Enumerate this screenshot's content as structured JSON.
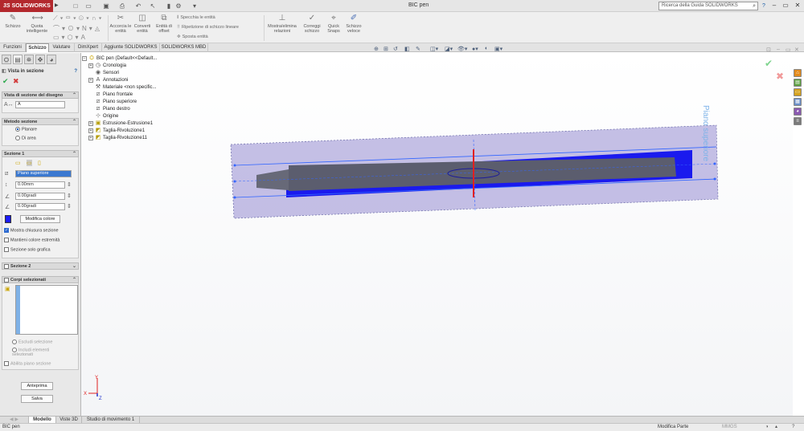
{
  "titlebar": {
    "logo": "SOLIDWORKS",
    "logo_ds": "3S",
    "doc_title": "BIC pen",
    "search_placeholder": "Ricerca della Guida SOLIDWORKS"
  },
  "ribbon": {
    "schizzo": "Schizzo",
    "quota_intelligente": "Quota intelligente",
    "accorcia_entita": "Accorcia le entità",
    "converti_entita": "Converti entità",
    "entita_offset": "Entità di offset",
    "specchia": "Specchia le entità",
    "ripetizione": "Ripetizione di schizzo lineare",
    "sposta": "Sposta entità",
    "mostra_elimina": "Mostra/elimina relazioni",
    "correggi": "Correggi schizzo",
    "quick_snaps": "Quick Snaps",
    "schizzo_veloce": "Schizzo veloce"
  },
  "cmd_tabs": [
    "Funzioni",
    "Schizzo",
    "Valutare",
    "DimXpert",
    "Aggiunte SOLIDWORKS",
    "SOLIDWORKS MBD"
  ],
  "propman": {
    "title": "Vista in sezione",
    "vista_label": "Vista di sezione del disegno",
    "vista_value": "A",
    "metodo_label": "Metodo sezione",
    "planare": "Planare",
    "di_area": "Di area",
    "sezione1": "Sezione 1",
    "plane_value": "Piano superiore",
    "offset_value": "0.00mm",
    "angle1_value": "0.00gradi",
    "angle2_value": "0.00gradi",
    "modifica_colore": "Modifica colore",
    "mostra_chiusura": "Mostra chiusura sezione",
    "mantieni_colore": "Mantieni colore estremità",
    "sezione_grafica": "Sezione solo grafica",
    "sezione2": "Sezione 2",
    "corpi_selezionati": "Corpi selezionati",
    "escludi": "Escludi selezione",
    "includi": "Includi elementi selezionati",
    "abilita_piano": "Abilita piano sezione",
    "anteprima": "Anteprima",
    "salva": "Salva"
  },
  "tree": {
    "root": "BIC pen  (Default<<Default...",
    "items": [
      "Cronologia",
      "Sensori",
      "Annotazioni",
      "Materiale <non specific...",
      "Piano frontale",
      "Piano superiore",
      "Piano destro",
      "Origine",
      "Estrusione-Estrusione1",
      "Taglia-Rivoluzione1",
      "Taglia-Rivoluzione11"
    ]
  },
  "viewport": {
    "plane_label": "Piano superiore",
    "axis_x": "X",
    "axis_y": "Y",
    "axis_z": "Z"
  },
  "bottom_tabs": [
    "Modello",
    "Viste 3D",
    "Studio di movimento 1"
  ],
  "status": {
    "left": "BIC pen",
    "mode": "Modifica Parte",
    "units": "MMGS"
  }
}
